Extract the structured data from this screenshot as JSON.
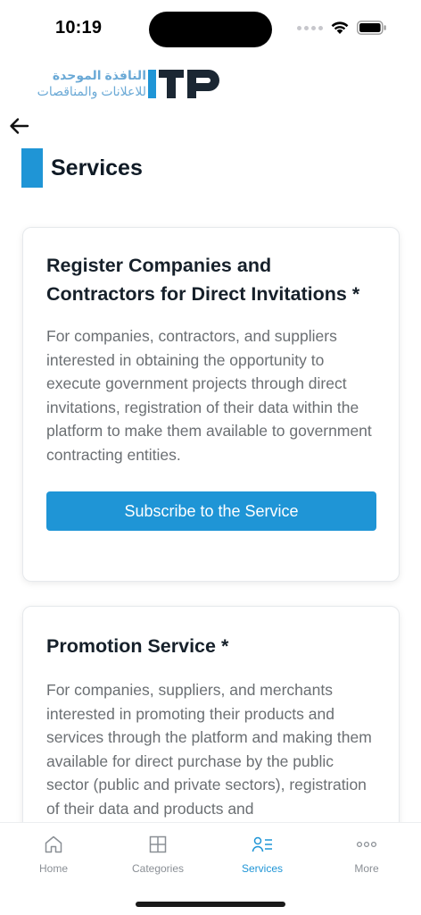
{
  "status_bar": {
    "time": "10:19"
  },
  "header": {
    "logo_arabic_line1": "النافذة الموحدة",
    "logo_arabic_line2": "للاعلانات والمناقصات",
    "logo_text": "ITP",
    "brand_color": "#1f95d6"
  },
  "page": {
    "title": "Services"
  },
  "cards": [
    {
      "title": "Register Companies and Contractors for Direct Invitations *",
      "description": "For companies, contractors, and suppliers interested in obtaining the opportunity to execute government projects through direct invitations, registration of their data within the platform to make them available to government contracting entities.",
      "button_label": "Subscribe to the Service"
    },
    {
      "title": "Promotion Service *",
      "description": "For companies, suppliers, and merchants interested in promoting their products and services through the platform and making them available for direct purchase by the public sector (public and private sectors), registration of their data and products and"
    }
  ],
  "tab_bar": {
    "items": [
      {
        "label": "Home",
        "icon": "home-icon",
        "active": false
      },
      {
        "label": "Categories",
        "icon": "grid-icon",
        "active": false
      },
      {
        "label": "Services",
        "icon": "services-icon",
        "active": true
      },
      {
        "label": "More",
        "icon": "more-icon",
        "active": false
      }
    ],
    "active_color": "#1f95d6",
    "inactive_color": "#8a8f95"
  }
}
